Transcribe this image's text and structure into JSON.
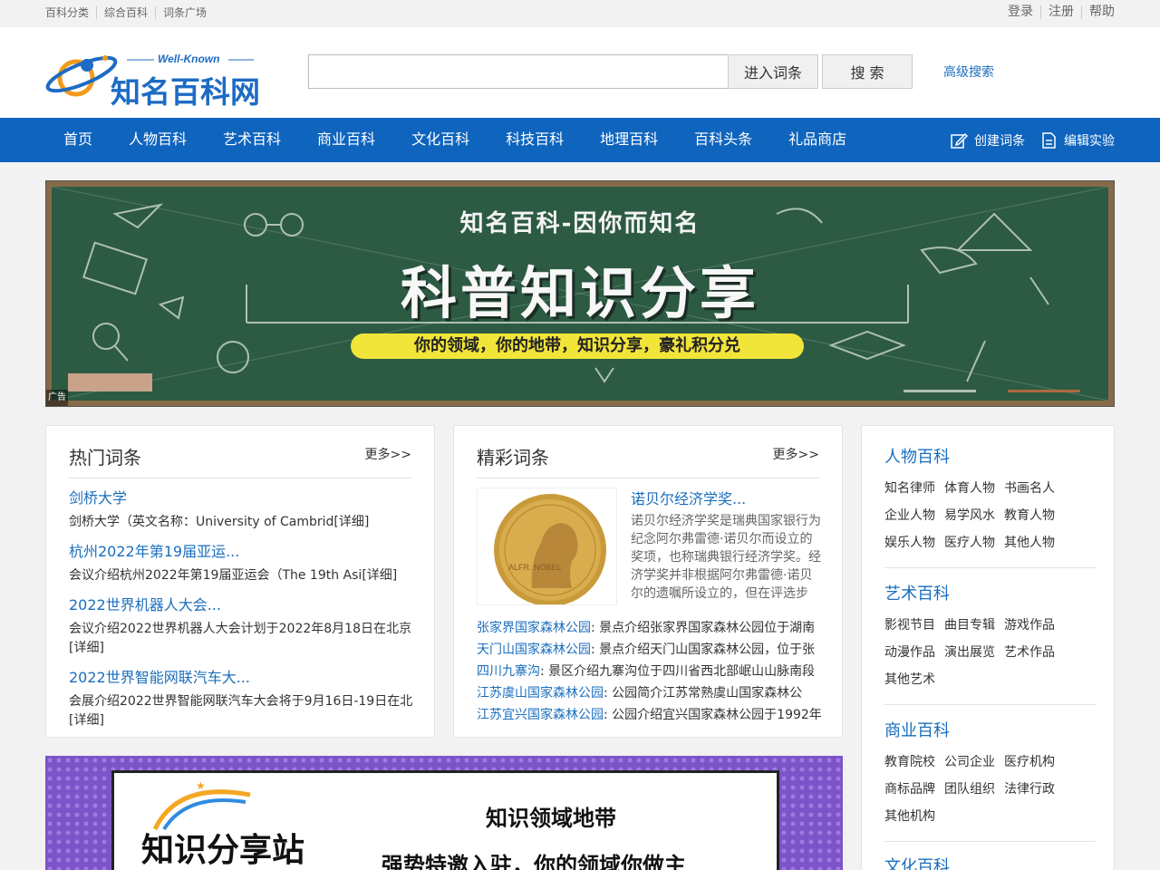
{
  "topbar": {
    "left_links": [
      "百科分类",
      "综合百科",
      "词条广场"
    ],
    "right_links": [
      "登录",
      "注册",
      "帮助"
    ]
  },
  "header": {
    "logo_en": "Well-Known",
    "logo_cn": "知名百科网",
    "search_placeholder": "",
    "enter_button": "进入词条",
    "search_button": "搜 索",
    "advanced_search": "高级搜索"
  },
  "nav": {
    "items": [
      "首页",
      "人物百科",
      "艺术百科",
      "商业百科",
      "文化百科",
      "科技百科",
      "地理百科",
      "百科头条",
      "礼品商店"
    ],
    "create_entry": "创建词条",
    "edit_lab": "编辑实验"
  },
  "banner": {
    "title": "知名百科-因你而知名",
    "main": "科普知识分享",
    "sub": "你的领域，你的地带，知识分享，豪礼积分兑",
    "ad_label": "广告"
  },
  "hot": {
    "title": "热门词条",
    "more": "更多>>",
    "items": [
      {
        "title": "剑桥大学",
        "desc": "剑桥大学（英文名称：University of Cambrid[详细]"
      },
      {
        "title": "杭州2022年第19届亚运...",
        "desc": "会议介绍杭州2022年第19届亚运会（The 19th Asi[详细]"
      },
      {
        "title": "2022世界机器人大会...",
        "desc": "会议介绍2022世界机器人大会计划于2022年8月18日在北京[详细]"
      },
      {
        "title": "2022世界智能网联汽车大...",
        "desc": "会展介绍2022世界智能网联汽车大会将于9月16日-19日在北[详细]"
      }
    ]
  },
  "featured": {
    "title": "精彩词条",
    "more": "更多>>",
    "main_title": "诺贝尔经济学奖...",
    "main_desc": "诺贝尔经济学奖是瑞典国家银行为纪念阿尔弗雷德·诺贝尔而设立的奖项，也称瑞典银行经济学奖。经济学奖并非根据阿尔弗雷德·诺贝尔的遗嘱所设立的，但在评选步",
    "medal_text": "ALFR. NOBEL",
    "list": [
      {
        "link": "张家界国家森林公园",
        "text": ": 景点介绍张家界国家森林公园位于湖南"
      },
      {
        "link": "天门山国家森林公园",
        "text": ": 景点介绍天门山国家森林公园，位于张"
      },
      {
        "link": "四川九寨沟",
        "text": ": 景区介绍九寨沟位于四川省西北部岷山山脉南段"
      },
      {
        "link": "江苏虞山国家森林公园",
        "text": ": 公园简介江苏常熟虞山国家森林公"
      },
      {
        "link": "江苏宜兴国家森林公园",
        "text": ": 公园介绍宜兴国家森林公园于1992年"
      }
    ]
  },
  "sidebar": {
    "sections": [
      {
        "title": "人物百科",
        "tags": [
          "知名律师",
          "体育人物",
          "书画名人",
          "企业人物",
          "易学风水",
          "教育人物",
          "娱乐人物",
          "医疗人物",
          "其他人物"
        ]
      },
      {
        "title": "艺术百科",
        "tags": [
          "影视节目",
          "曲目专辑",
          "游戏作品",
          "动漫作品",
          "演出展览",
          "艺术作品",
          "其他艺术"
        ]
      },
      {
        "title": "商业百科",
        "tags": [
          "教育院校",
          "公司企业",
          "医疗机构",
          "商标品牌",
          "团队组织",
          "法律行政",
          "其他机构"
        ]
      },
      {
        "title": "文化百科",
        "tags": []
      }
    ]
  },
  "bottom_banner": {
    "left": "知识分享站",
    "right_line1": "知识领域地带",
    "right_line2": "强势特邀入驻，你的领域你做主"
  },
  "colors": {
    "nav_bg": "#0f64bd",
    "link_blue": "#1a6ebd",
    "board_green": "#2d5a43"
  }
}
